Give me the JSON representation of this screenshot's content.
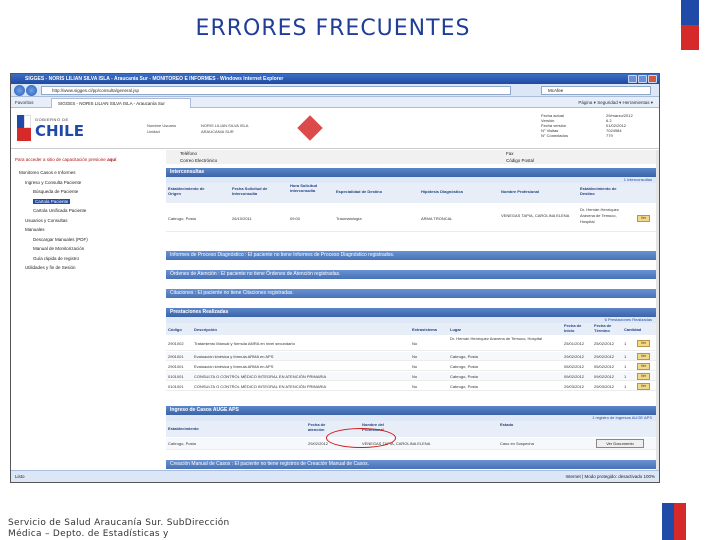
{
  "slide": {
    "title": "ERRORES  FRECUENTES",
    "footer_line1": "Servicio de Salud Araucanía Sur. SubDirección",
    "footer_line2": "Médica – Depto. de Estadísticas y"
  },
  "browser": {
    "window_title": "SIGGES - NORIS LILIAN SILVA ISLA - Araucanía Sur - MONITOREO E INFORMES - Windows Internet Explorer",
    "address": "http://www.sigges.cl/pp/consulta/general.jsp",
    "search_engine": "McAfee",
    "tab_label": "SIGGES - NORIS LILIAN SILVA ISLA - Araucanía Sur",
    "favorites": "Favoritos",
    "tools": "Página ▾  Seguridad ▾  Herramientas ▾",
    "status_left": "Listo",
    "status_right": "Internet | Modo protegido: desactivado   100%"
  },
  "app": {
    "logo_small": "GOBIERNO DE",
    "logo_big": "CHILE",
    "user_label": "Nombre Usuario",
    "user_value": "NORIS LILIAN SILVA ISLA",
    "unit_label": "Unidad",
    "unit_value": "ARAUCANIA SUR",
    "meta_labels": [
      "Fecha actual",
      "Versión",
      "Fecha versión",
      "N° Visitas",
      "N° Conectados"
    ],
    "meta_values": [
      "29/marzo/2012",
      "6.2",
      "01/02/2012",
      "7024984",
      "779"
    ]
  },
  "sidebar": {
    "link_text": "Para acceder a sitio de capacitación presione",
    "link_here": "aquí",
    "tree": [
      "Monitoreo Casos e Informes",
      "Ingreso y Consulta Paciente",
      "Búsqueda de Paciente",
      "Cartola Paciente",
      "Cartola Unificada Paciente",
      "Usuarios y Consultas",
      "Manuales",
      "Descargar Manuales (PDF)",
      "Manual de Monitorización",
      "Guía rápida de registro",
      "Utilidades y fin de Sesión"
    ]
  },
  "main": {
    "top_labels": [
      "Teléfono",
      "Correo Electrónico"
    ],
    "top_right_labels": [
      "Fax",
      "Código Postal"
    ],
    "interconsultas": {
      "title": "Interconsultas",
      "count": "1 Interconsultas",
      "columns": [
        "Establecimiento de Origen",
        "Fecha Solicitud de Interconsulta",
        "Hora Solicitud interconsulta",
        "Especialidad de Destino",
        "Hipótesis Diagnóstica",
        "Nombre Profesional",
        "Establecimiento de Destino"
      ],
      "row": [
        "Cabrugo, Posta",
        "26/10/2011",
        "09:00",
        "Traumatología",
        "ARMA TRONCAL",
        "VENEGAS TAPIA, CAROLINA ELENA",
        "Dr. Hernán Henríquez Aravena de Temuco, Hospital"
      ]
    },
    "informes": "Informes de Proceso Diagnóstico : El paciente no tiene Informes de Proceso Diagnóstico registrados.",
    "ordenes": "Órdenes de Atención : El paciente no tiene Órdenes de Atención registradas.",
    "citaciones": "Citaciones : El paciente no tiene Citaciones registradas.",
    "prestaciones": {
      "title": "Prestaciones Realizadas",
      "count": "6 Prestaciones Realizadas",
      "columns": [
        "Código",
        "Descripción",
        "Extrasistema",
        "Lugar",
        "Fecha de Inicio",
        "Fecha de Término",
        "Cantidad"
      ],
      "rows": [
        [
          "2901002",
          "Tratamiento Manual y fórmula AMRA en nivel secundario",
          "No",
          "Dr. Hernán Henríquez Aravena de Temuco, Hospital",
          "25/01/2012",
          "25/02/2012",
          "1"
        ],
        [
          "2901001",
          "Evaluación kinésica y fórmula ARMA en APS",
          "No",
          "Cabrugo, Posta",
          "29/02/2012",
          "29/02/2012",
          "1"
        ],
        [
          "2901001",
          "Evaluación kinésica y fórmula ARMA en APS",
          "No",
          "Cabrugo, Posta",
          "05/02/2012",
          "05/02/2012",
          "1"
        ],
        [
          "0101001",
          "CONSULTA O CONTROL MÉDICO INTEGRAL EN ATENCIÓN PRIMARIA",
          "No",
          "Cabrugo, Posta",
          "09/02/2012",
          "09/02/2012",
          "1"
        ],
        [
          "0101001",
          "CONSULTA O CONTROL MÉDICO INTEGRAL EN ATENCIÓN PRIMARIA",
          "No",
          "Cabrugo, Posta",
          "29/03/2012",
          "29/03/2012",
          "1"
        ]
      ]
    },
    "auge": {
      "title": "Ingreso de Casos AUGE APS",
      "count": "1 registro de Ingresos AUGE APS",
      "columns": [
        "Establecimiento",
        "Fecha de atención",
        "Nombre del Profesional",
        "Estado"
      ],
      "row": [
        "Cabrugo, Posta",
        "29/02/2012",
        "VENEGAS TAPIA, CAROLINA ELENA",
        "Caso en Sospecha"
      ],
      "button": "Ver Documento"
    },
    "creacion": "Creación Manual de Casos : El paciente no tiene registros de Creación Manual de Casos.",
    "view_label": "Ver"
  }
}
